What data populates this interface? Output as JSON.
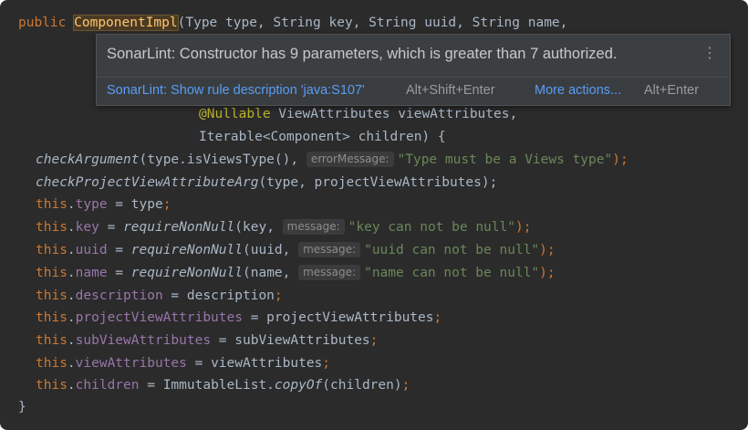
{
  "code": {
    "line1": {
      "kw": "public",
      "name": "ComponentImpl",
      "rest": "(Type type, String key, String uuid, String name,"
    },
    "line2": {
      "ann": "@Nullable",
      "rest": " ViewAttributes viewAttributes,"
    },
    "line3": "Iterable<Component> children) {",
    "line4": {
      "call": "checkArgument",
      "a": "(type.isViewsType(), ",
      "hint": "errorMessage:",
      "str": "\"Type must be a Views type\"",
      "end": ");"
    },
    "line5": {
      "call": "checkProjectViewAttributeArg",
      "a": "(type, projectViewAttributes);"
    },
    "line6": {
      "this": "this",
      "field": "type",
      "a": " = type",
      "semi": ";"
    },
    "line7": {
      "this": "this",
      "field": "key",
      "a": " = ",
      "call": "requireNonNull",
      "b": "(key, ",
      "hint": "message:",
      "str": "\"key can not be null\"",
      "end": ");"
    },
    "line8": {
      "this": "this",
      "field": "uuid",
      "a": " = ",
      "call": "requireNonNull",
      "b": "(uuid, ",
      "hint": "message:",
      "str": "\"uuid can not be null\"",
      "end": ");"
    },
    "line9": {
      "this": "this",
      "field": "name",
      "a": " = ",
      "call": "requireNonNull",
      "b": "(name, ",
      "hint": "message:",
      "str": "\"name can not be null\"",
      "end": ");"
    },
    "line10": {
      "this": "this",
      "field": "description",
      "a": " = description",
      "semi": ";"
    },
    "line11": {
      "this": "this",
      "field": "projectViewAttributes",
      "a": " = projectViewAttributes",
      "semi": ";"
    },
    "line12": {
      "this": "this",
      "field": "subViewAttributes",
      "a": " = subViewAttributes",
      "semi": ";"
    },
    "line13": {
      "this": "this",
      "field": "viewAttributes",
      "a": " = viewAttributes",
      "semi": ";"
    },
    "line14": {
      "this": "this",
      "field": "children",
      "a": " = ImmutableList.",
      "call": "copyOf",
      "b": "(children)",
      "semi": ";"
    },
    "line15": "}"
  },
  "popup": {
    "message": "SonarLint: Constructor has 9 parameters, which is greater than 7 authorized.",
    "menu_icon": "⋮",
    "action1": "SonarLint: Show rule description 'java:S107'",
    "action1_shortcut": "Alt+Shift+Enter",
    "action2": "More actions...",
    "action2_shortcut": "Alt+Enter"
  }
}
